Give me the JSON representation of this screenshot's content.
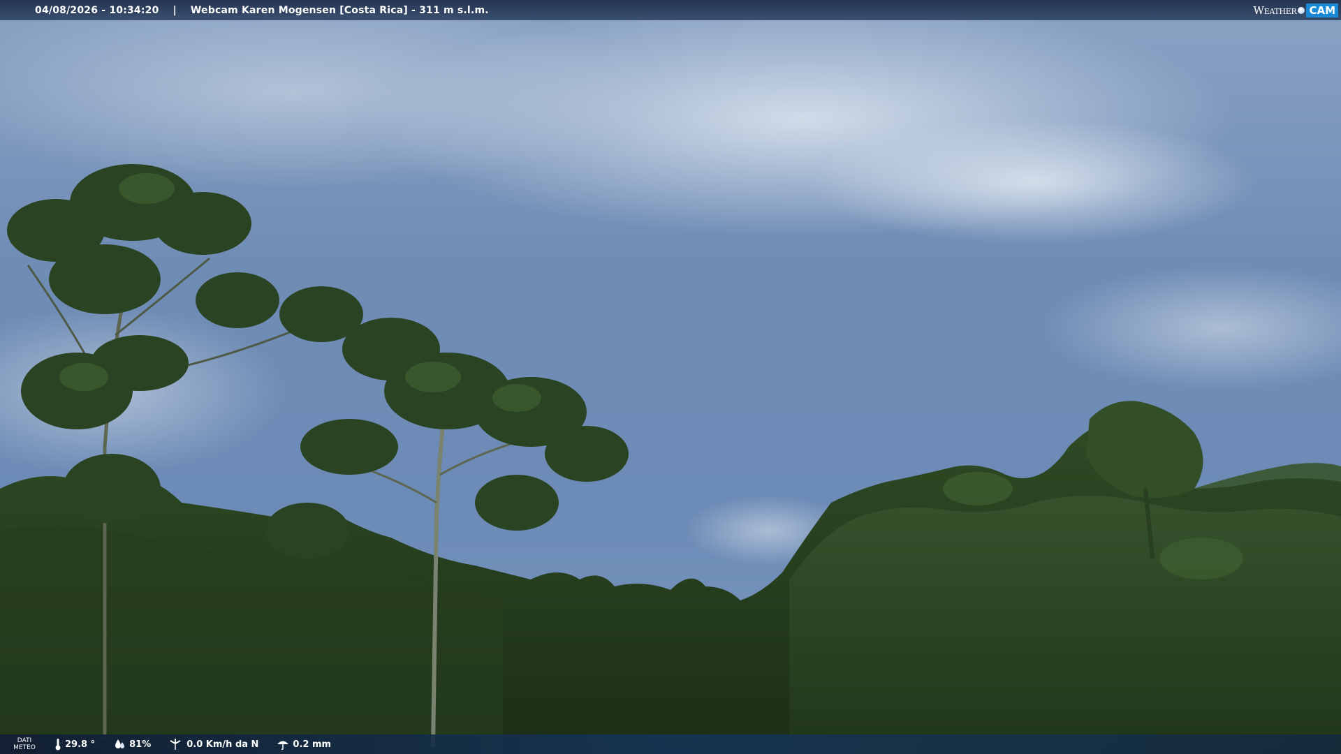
{
  "header": {
    "datetime": "04/08/2026 - 10:34:20",
    "separator": "|",
    "title": "Webcam Karen Mogensen [Costa Rica]  - 311 m s.l.m."
  },
  "brand": {
    "weather": "Weather",
    "cam": "CAM"
  },
  "weather_bar": {
    "label_line1": "DATI",
    "label_line2": "METEO",
    "temperature": "29.8 °",
    "humidity": "81%",
    "wind": "0.0 Km/h da N",
    "rain": "0.2 mm"
  },
  "icons": {
    "temperature": "thermometer-icon",
    "humidity": "droplets-icon",
    "wind": "wind-icon",
    "rain": "umbrella-icon",
    "brand": "globe-icon"
  },
  "colors": {
    "sky": "#6f8fb8",
    "foliage": "#27401f",
    "bar": "#1c2c48",
    "brand_accent": "#1a8ad6"
  }
}
